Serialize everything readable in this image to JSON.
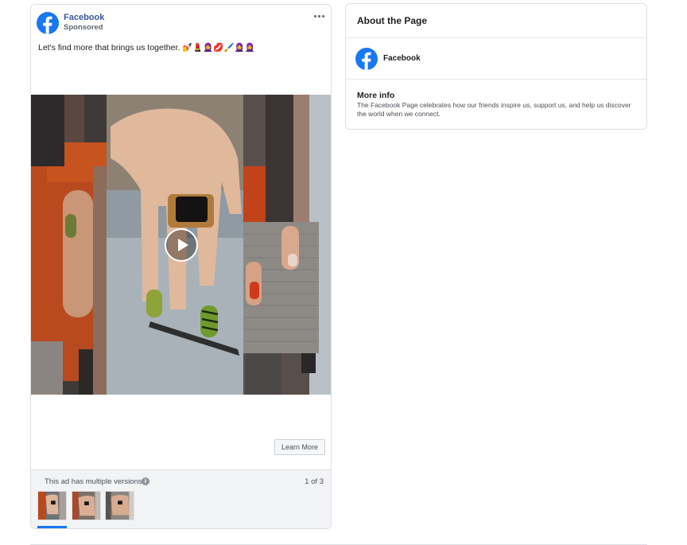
{
  "ad": {
    "page_name": "Facebook",
    "sponsored_label": "Sponsored",
    "more_options_icon": "more-horizontal-icon",
    "body_text": "Let's find more that brings us together. 💅💄🧕💋🖌️🧕🧕",
    "video": {
      "play_icon": "play-icon",
      "state": "paused"
    },
    "cta_label": "Learn More",
    "versions": {
      "text": "This ad has multiple versions.",
      "info_icon": "info-icon",
      "counter": "1 of 3",
      "current": 1,
      "total": 3,
      "thumbnails": [
        "version-1",
        "version-2",
        "version-3"
      ]
    }
  },
  "about": {
    "title": "About the Page",
    "page_name": "Facebook",
    "more_info_title": "More info",
    "more_info_body": "The Facebook Page celebrates how our friends inspire us, support us, and help us discover the world when we connect."
  },
  "colors": {
    "brand": "#1877f2",
    "page_name_link": "#385898",
    "footer_background": "#f2f3f5",
    "border": "#dddfe2"
  }
}
